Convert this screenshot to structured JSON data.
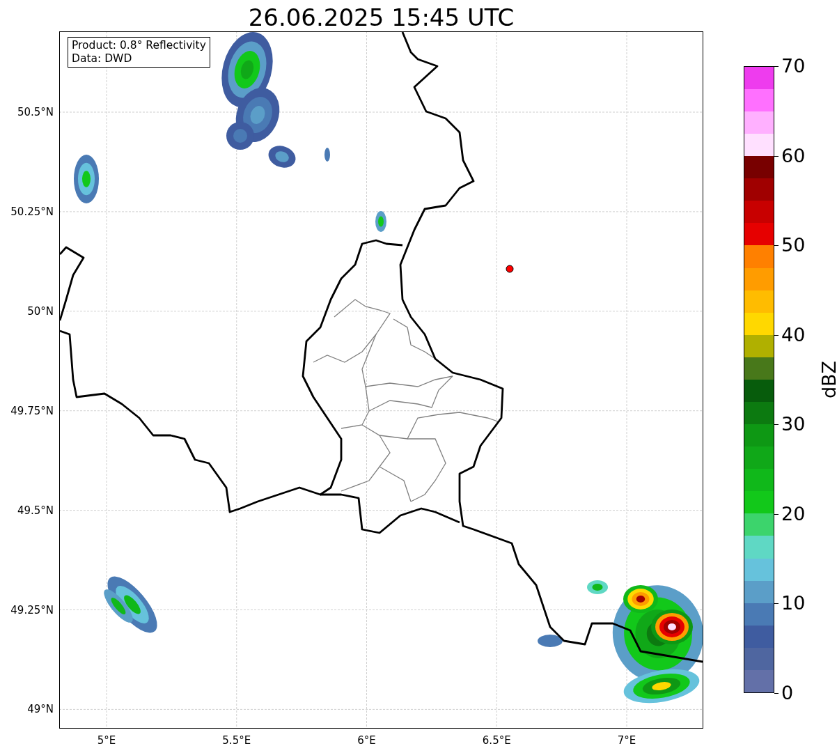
{
  "title": "26.06.2025 15:45 UTC",
  "legend": [
    "Product: 0.8° Reflectivity",
    "Data: DWD"
  ],
  "x_ticks": [
    "5°E",
    "5.5°E",
    "6°E",
    "6.5°E",
    "7°E"
  ],
  "y_ticks": [
    "50.5°N",
    "50.25°N",
    "50°N",
    "49.75°N",
    "49.5°N",
    "49.25°N",
    "49°N"
  ],
  "colorbar": {
    "label": "dBZ",
    "ticks": [
      "70",
      "60",
      "50",
      "40",
      "30",
      "20",
      "10",
      "0"
    ],
    "segments": [
      {
        "color": "#6370a8"
      },
      {
        "color": "#4f66a0"
      },
      {
        "color": "#3f5ca0"
      },
      {
        "color": "#4a7ab4"
      },
      {
        "color": "#5b9ec8"
      },
      {
        "color": "#66c2dc"
      },
      {
        "color": "#5fd8c4"
      },
      {
        "color": "#3cd46c"
      },
      {
        "color": "#12c81a"
      },
      {
        "color": "#10b81a"
      },
      {
        "color": "#10a818"
      },
      {
        "color": "#0e9814"
      },
      {
        "color": "#0c7a10"
      },
      {
        "color": "#075c0c"
      },
      {
        "color": "#48781a"
      },
      {
        "color": "#b0b000"
      },
      {
        "color": "#ffd800"
      },
      {
        "color": "#ffbc00"
      },
      {
        "color": "#ff9c00"
      },
      {
        "color": "#ff8000"
      },
      {
        "color": "#e60000"
      },
      {
        "color": "#c80000"
      },
      {
        "color": "#a00000"
      },
      {
        "color": "#780000"
      },
      {
        "color": "#ffe0ff"
      },
      {
        "color": "#ffb0ff"
      },
      {
        "color": "#ff70ff"
      },
      {
        "color": "#ee3cee"
      }
    ]
  }
}
